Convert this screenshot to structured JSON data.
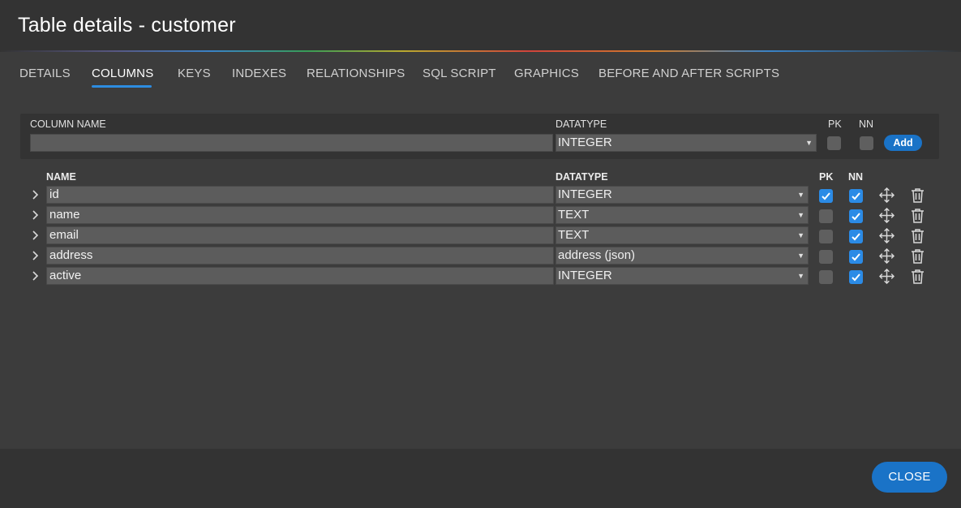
{
  "window": {
    "title": "Table details - customer"
  },
  "tabs": [
    {
      "label": "DETAILS"
    },
    {
      "label": "COLUMNS"
    },
    {
      "label": "KEYS"
    },
    {
      "label": "INDEXES"
    },
    {
      "label": "RELATIONSHIPS"
    },
    {
      "label": "SQL SCRIPT"
    },
    {
      "label": "GRAPHICS"
    },
    {
      "label": "BEFORE AND AFTER SCRIPTS"
    }
  ],
  "new_column": {
    "name_label": "COLUMN NAME",
    "name_value": "",
    "datatype_label": "DATATYPE",
    "datatype_value": "INTEGER",
    "pk_label": "PK",
    "nn_label": "NN",
    "pk_checked": false,
    "nn_checked": false,
    "add_label": "Add"
  },
  "columns_table": {
    "headers": {
      "name": "NAME",
      "datatype": "DATATYPE",
      "pk": "PK",
      "nn": "NN"
    },
    "rows": [
      {
        "name": "id",
        "datatype": "INTEGER",
        "pk": true,
        "nn": true
      },
      {
        "name": "name",
        "datatype": "TEXT",
        "pk": false,
        "nn": true
      },
      {
        "name": "email",
        "datatype": "TEXT",
        "pk": false,
        "nn": true
      },
      {
        "name": "address",
        "datatype": "address (json)",
        "pk": false,
        "nn": true
      },
      {
        "name": "active",
        "datatype": "INTEGER",
        "pk": false,
        "nn": true
      }
    ]
  },
  "footer": {
    "close_label": "CLOSE"
  },
  "colors": {
    "accent": "#2b8be6",
    "button": "#1a73c7",
    "background": "#3c3c3c"
  },
  "icons": {
    "expand": "chevron-right-icon",
    "move": "move-icon",
    "delete": "trash-icon",
    "caret": "caret-down-icon"
  }
}
